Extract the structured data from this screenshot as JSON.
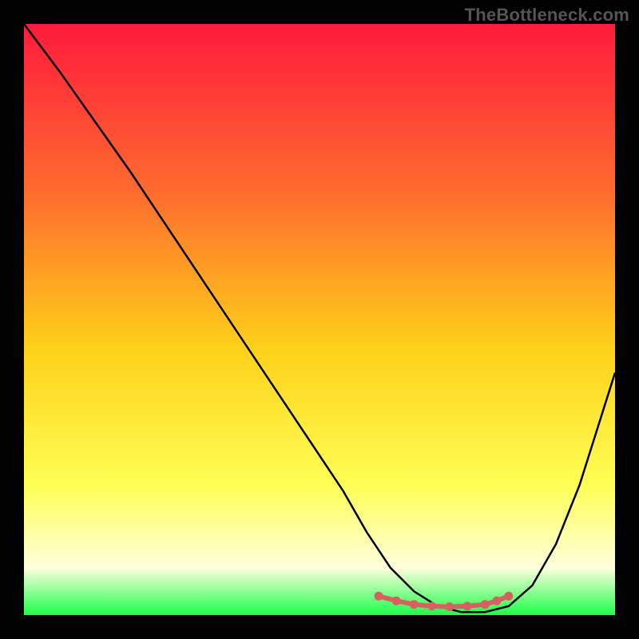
{
  "watermark": "TheBottleneck.com",
  "colors": {
    "gradient_top": "#ff1a3c",
    "gradient_mid_upper": "#ff6a2f",
    "gradient_mid": "#ffd119",
    "gradient_mid_lower": "#ffff55",
    "gradient_bottom_pale": "#ffffdd",
    "gradient_bottom": "#1cff4a",
    "curve": "#000000",
    "markers": "#d96060",
    "frame_bg": "#000000"
  },
  "chart_data": {
    "type": "line",
    "title": "",
    "xlabel": "",
    "ylabel": "",
    "xlim": [
      0,
      100
    ],
    "ylim": [
      0,
      100
    ],
    "grid": false,
    "legend": false,
    "series": [
      {
        "name": "bottleneck-curve",
        "x": [
          0,
          6,
          12,
          18,
          24,
          30,
          36,
          42,
          48,
          54,
          58,
          62,
          66,
          70,
          74,
          78,
          82,
          86,
          90,
          94,
          100
        ],
        "y": [
          100,
          92,
          83.5,
          75,
          66,
          57,
          48,
          39,
          30,
          21,
          14,
          8,
          4,
          1.5,
          0.5,
          0.5,
          1.5,
          5,
          12,
          22,
          41
        ]
      }
    ],
    "markers": {
      "name": "highlight-band",
      "x": [
        60,
        63,
        66,
        69,
        72,
        75,
        78,
        80,
        82
      ],
      "y": [
        3.2,
        2.4,
        1.8,
        1.5,
        1.4,
        1.5,
        1.8,
        2.4,
        3.2
      ]
    }
  }
}
